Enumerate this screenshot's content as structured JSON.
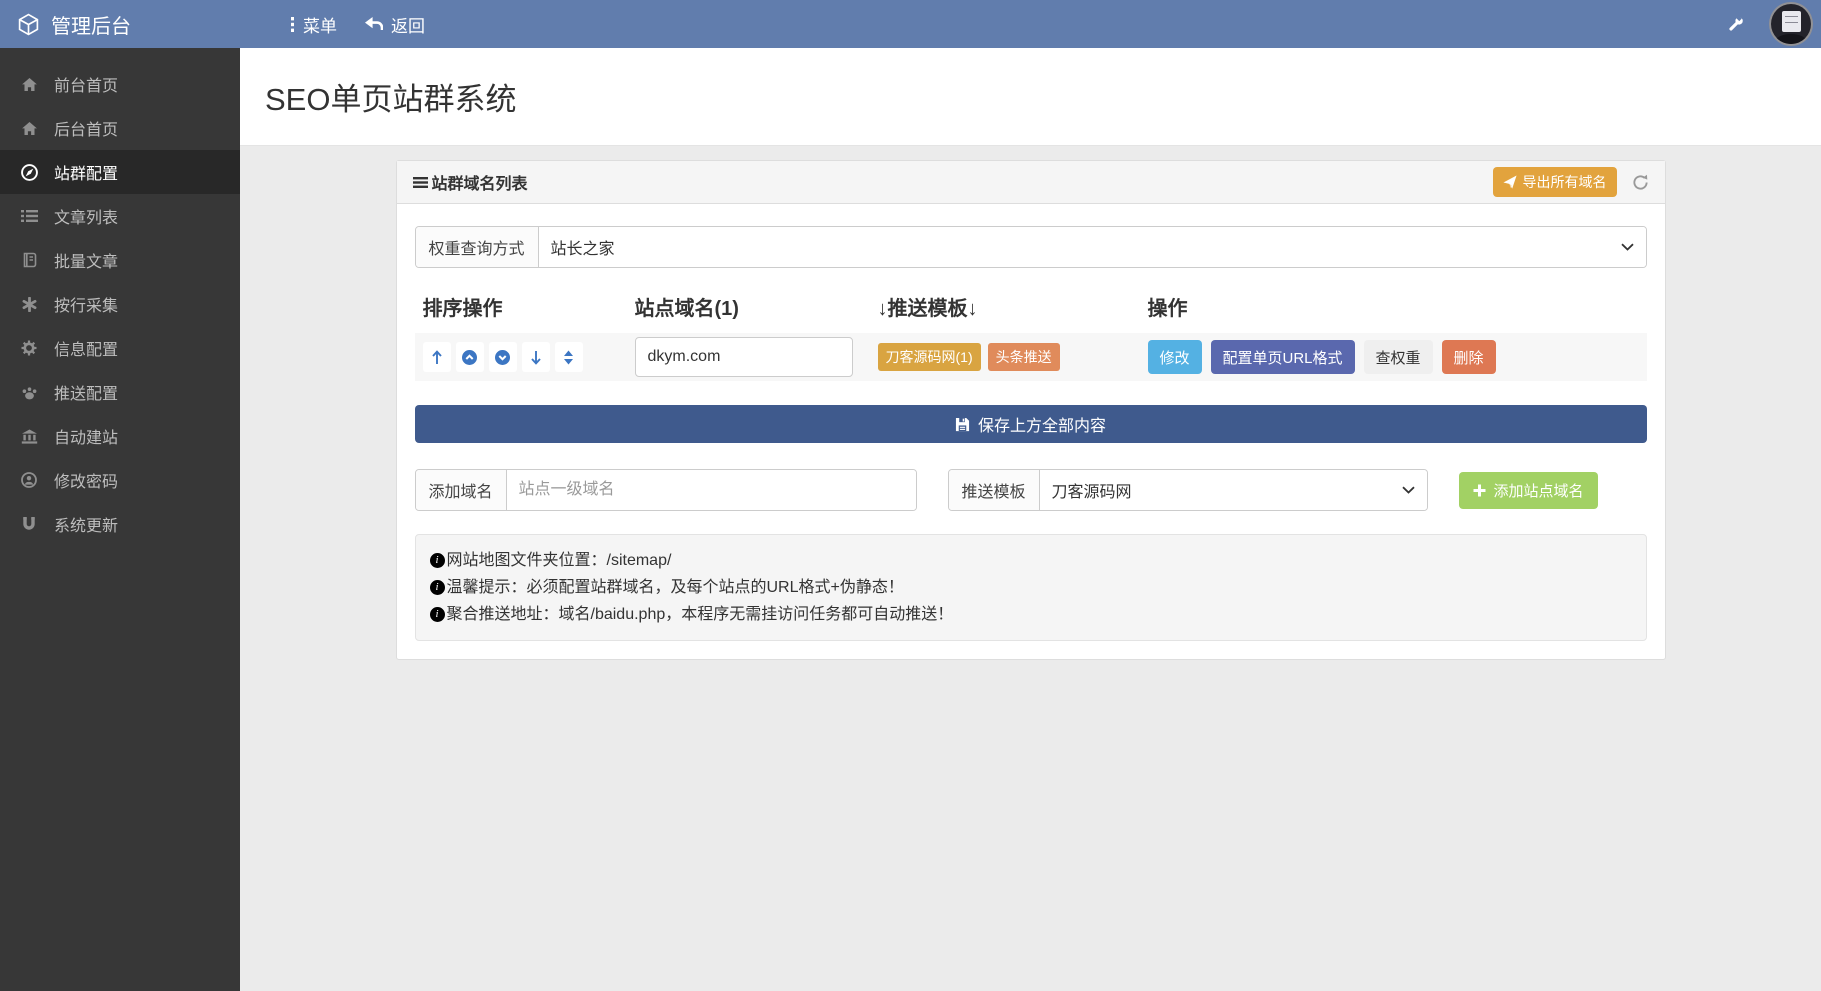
{
  "navbar": {
    "brand": "管理后台",
    "menu": "菜单",
    "back": "返回"
  },
  "sidebar": {
    "items": [
      {
        "label": "前台首页",
        "icon": "home-icon",
        "active": false
      },
      {
        "label": "后台首页",
        "icon": "home-icon",
        "active": false
      },
      {
        "label": "站群配置",
        "icon": "compass-icon",
        "active": true
      },
      {
        "label": "文章列表",
        "icon": "list-icon",
        "active": false
      },
      {
        "label": "批量文章",
        "icon": "book-icon",
        "active": false
      },
      {
        "label": "按行采集",
        "icon": "asterisk-icon",
        "active": false
      },
      {
        "label": "信息配置",
        "icon": "gear-icon",
        "active": false
      },
      {
        "label": "推送配置",
        "icon": "paw-icon",
        "active": false
      },
      {
        "label": "自动建站",
        "icon": "bank-icon",
        "active": false
      },
      {
        "label": "修改密码",
        "icon": "user-circle-icon",
        "active": false
      },
      {
        "label": "系统更新",
        "icon": "magnet-icon",
        "active": false
      }
    ]
  },
  "page": {
    "title": "SEO单页站群系统"
  },
  "panel": {
    "title": "站群域名列表",
    "export_button": "导出所有域名",
    "weight_query": {
      "label": "权重查询方式",
      "value": "站长之家"
    },
    "table": {
      "headers": [
        "排序操作",
        "站点域名(1)",
        "↓推送模板↓",
        "操作"
      ],
      "row": {
        "domain": "dkym.com",
        "tags": [
          "刀客源码网(1)",
          "头条推送"
        ],
        "actions": [
          "修改",
          "配置单页URL格式",
          "查权重",
          "删除"
        ]
      }
    },
    "save_button": "保存上方全部内容",
    "add_domain": {
      "label": "添加域名",
      "placeholder": "站点一级域名"
    },
    "push_template": {
      "label": "推送模板",
      "value": "刀客源码网"
    },
    "add_button": "添加站点域名",
    "notes": [
      "网站地图文件夹位置：/sitemap/",
      "温馨提示：必须配置站群域名，及每个站点的URL格式+伪静态！",
      "聚合推送地址：域名/baidu.php，本程序无需挂访问任务都可自动推送！"
    ]
  },
  "colors": {
    "navbar": "#617dad",
    "sidebar": "#373737",
    "sidebar_active": "#282828",
    "page_bg": "#ebebeb",
    "panel_header_bg": "#f5f5f5",
    "export_btn": "#e2a33d",
    "tag_template": "#d9a441",
    "tag_toutiao": "#e08b5b",
    "btn_edit": "#54b1e3",
    "btn_config": "#5a68ae",
    "btn_weight_bg": "#efefef",
    "btn_delete": "#de7853",
    "save_btn": "#3f5a8d",
    "add_btn": "#a2d164",
    "sort_icon": "#3c76c3"
  }
}
